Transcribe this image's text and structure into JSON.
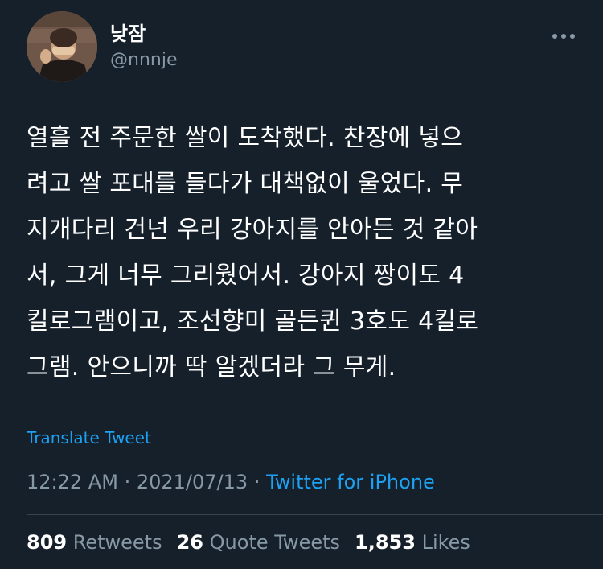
{
  "author": {
    "display_name": "낮잠",
    "handle": "@nnnje"
  },
  "tweet": {
    "text": "열흘 전 주문한 쌀이 도착했다. 찬장에 넣으\n려고 쌀 포대를 들다가 대책없이 울었다. 무\n지개다리 건넌 우리 강아지를 안아든 것 같아\n서, 그게 너무 그리웠어서. 강아지 짱이도 4\n킬로그램이고, 조선향미 골든퀸 3호도 4킬로\n그램. 안으니까 딱 알겠더라 그 무게.",
    "translate_label": "Translate Tweet",
    "time": "12:22 AM",
    "date": "2021/07/13",
    "separator": "·",
    "source": "Twitter for iPhone"
  },
  "stats": {
    "retweets_count": "809",
    "retweets_label": "Retweets",
    "quote_tweets_count": "26",
    "quote_tweets_label": "Quote Tweets",
    "likes_count": "1,853",
    "likes_label": "Likes"
  },
  "colors": {
    "background": "#15202b",
    "text": "#ffffff",
    "secondary": "#8899a6",
    "accent": "#1da1f2",
    "divider": "#38444d"
  },
  "icons": {
    "more": "more-horizontal-icon"
  }
}
